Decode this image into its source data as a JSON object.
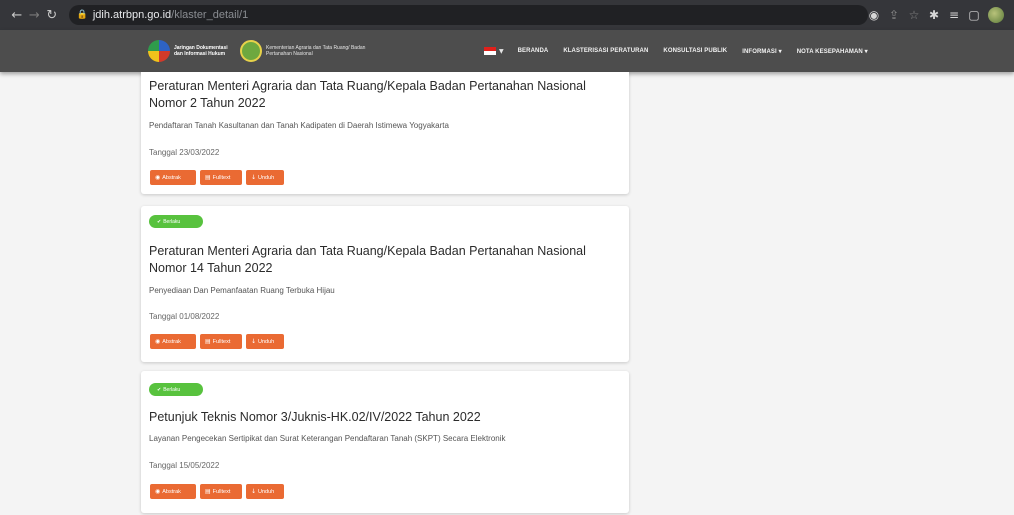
{
  "browser": {
    "url_host": "jdih.atrbpn.go.id",
    "url_path": "/klaster_detail/1"
  },
  "header": {
    "logo1_text": "Jaringan Dokumentasi dan Informasi Hukum",
    "logo2_text": "Kementerian Agraria dan Tata Ruang/ Badan Pertanahan Nasional",
    "menu": [
      "BERANDA",
      "KLASTERISASI PERATURAN",
      "KONSULTASI PUBLIK",
      "INFORMASI ▾",
      "NOTA KESEPAHAMAN ▾"
    ]
  },
  "cards": [
    {
      "title": "Peraturan Menteri Agraria dan Tata Ruang/Kepala Badan Pertanahan Nasional Nomor 2 Tahun 2022",
      "subtitle": "Pendaftaran Tanah Kasultanan dan Tanah Kadipaten di Daerah Istimewa Yogyakarta",
      "date": "Tanggal 23/03/2022"
    },
    {
      "badge": "Berlaku",
      "title": "Peraturan Menteri Agraria dan Tata Ruang/Kepala Badan Pertanahan Nasional Nomor 14 Tahun 2022",
      "subtitle": "Penyediaan Dan Pemanfaatan Ruang Terbuka Hijau",
      "date": "Tanggal 01/08/2022"
    },
    {
      "badge": "Berlaku",
      "title": "Petunjuk Teknis Nomor 3/Juknis-HK.02/IV/2022 Tahun 2022",
      "subtitle": "Layanan Pengecekan Sertipikat dan Surat Keterangan Pendaftaran Tanah (SKPT) Secara Elektronik",
      "date": "Tanggal 15/05/2022"
    }
  ],
  "buttons": {
    "abstrak": "Abstrak",
    "fulltext": "Fulltext",
    "unduh": "Unduh"
  },
  "colors": {
    "accent_orange": "#ea6a33",
    "badge_green": "#58c23e",
    "header_gray": "#4d4d4d"
  },
  "icons": {
    "abstrak": "eye-icon",
    "fulltext": "document-icon",
    "unduh": "download-icon",
    "badge": "check-icon"
  }
}
